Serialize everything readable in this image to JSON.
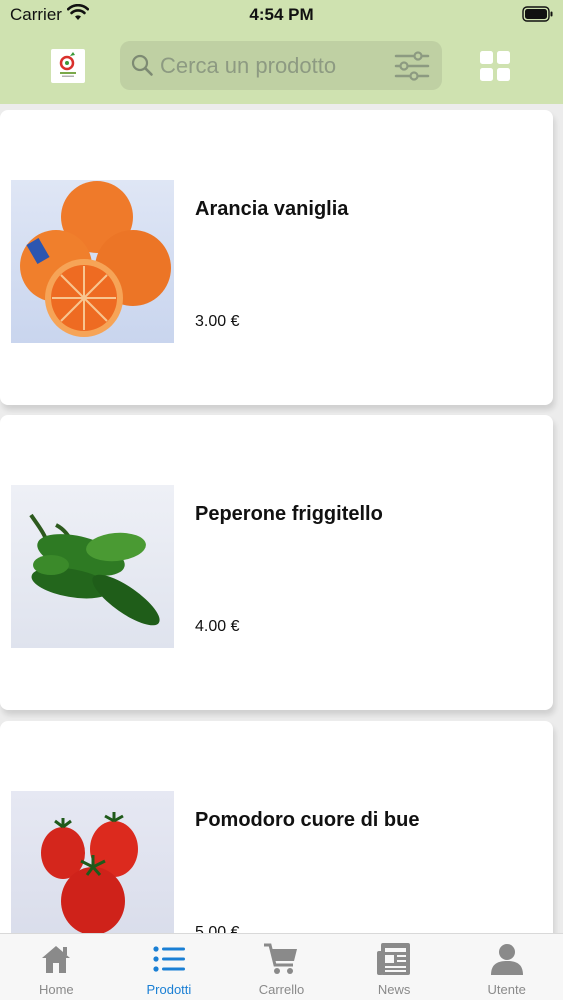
{
  "status_bar": {
    "carrier": "Carrier",
    "time": "4:54 PM"
  },
  "header": {
    "search_placeholder": "Cerca un prodotto"
  },
  "products": [
    {
      "name": "Arancia vaniglia",
      "price": "3.00 €"
    },
    {
      "name": "Peperone friggitello",
      "price": "4.00 €"
    },
    {
      "name": "Pomodoro cuore di bue",
      "price": "5.00 €"
    }
  ],
  "tabs": [
    {
      "label": "Home",
      "icon": "home-icon"
    },
    {
      "label": "Prodotti",
      "icon": "list-icon",
      "active": true
    },
    {
      "label": "Carrello",
      "icon": "cart-icon"
    },
    {
      "label": "News",
      "icon": "newspaper-icon"
    },
    {
      "label": "Utente",
      "icon": "user-icon"
    }
  ],
  "colors": {
    "header_bg": "#cfe2b0",
    "search_bg": "#bfd0a3",
    "tab_active": "#1a7fd4",
    "tab_inactive": "#8a8a8a"
  }
}
